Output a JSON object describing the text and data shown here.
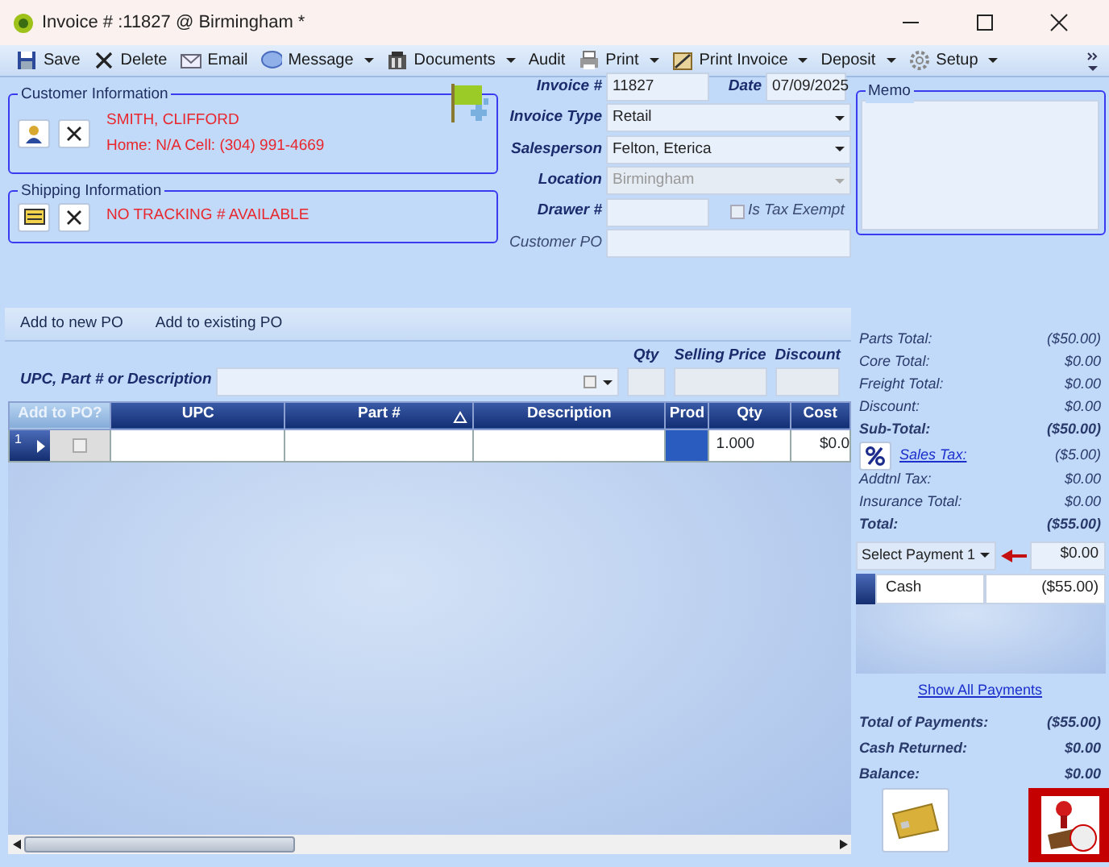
{
  "window": {
    "title": "Invoice # :11827 @ Birmingham *"
  },
  "toolbar": [
    {
      "label": "Save",
      "kind": "save",
      "dropdown": false
    },
    {
      "label": "Delete",
      "kind": "delete",
      "dropdown": false
    },
    {
      "label": "Email",
      "kind": "email",
      "dropdown": false
    },
    {
      "label": "Message",
      "kind": "message",
      "dropdown": true
    },
    {
      "label": "Documents",
      "kind": "documents",
      "dropdown": true
    },
    {
      "label": "Audit",
      "kind": "plain",
      "dropdown": false
    },
    {
      "label": "Print",
      "kind": "print",
      "dropdown": true
    },
    {
      "label": "Print Invoice",
      "kind": "printinvoice",
      "dropdown": true
    },
    {
      "label": "Deposit",
      "kind": "plain",
      "dropdown": true
    },
    {
      "label": "Setup",
      "kind": "setup",
      "dropdown": true
    }
  ],
  "customer": {
    "legend": "Customer Information",
    "name": "SMITH, CLIFFORD",
    "phone": "Home: N/A Cell: (304) 991-4669"
  },
  "shipping": {
    "legend": "Shipping Information",
    "tracking": "NO TRACKING # AVAILABLE"
  },
  "invoice": {
    "number": {
      "label": "Invoice #",
      "value": "11827"
    },
    "date": {
      "label": "Date",
      "value": "07/09/2025"
    },
    "type": {
      "label": "Invoice Type",
      "value": "Retail"
    },
    "salesperson": {
      "label": "Salesperson",
      "value": "Felton, Eterica"
    },
    "location": {
      "label": "Location",
      "value": "Birmingham",
      "disabled": true
    },
    "drawer": {
      "label": "Drawer #"
    },
    "tax_exempt": {
      "label": "Is Tax Exempt",
      "checked": false
    },
    "customer_po": {
      "label": "Customer PO"
    }
  },
  "po_tabs": [
    "Add to new PO",
    "Add to existing PO"
  ],
  "entry": {
    "label": "UPC, Part # or Description",
    "qty_label": "Qty",
    "price_label": "Selling Price",
    "discount_label": "Discount"
  },
  "grid": {
    "columns": [
      {
        "label": "Add to PO?",
        "sorted": false
      },
      {
        "label": "UPC",
        "sorted": false
      },
      {
        "label": "Part #",
        "sorted": true
      },
      {
        "label": "Description",
        "sorted": false
      },
      {
        "label": "Prod",
        "sorted": false
      },
      {
        "label": "Qty",
        "sorted": false
      },
      {
        "label": "Cost",
        "sorted": false
      }
    ],
    "rows": [
      {
        "row_no": "1",
        "add_to_po": false,
        "qty": "1.000",
        "cost": "$0.0"
      }
    ]
  },
  "memo": {
    "legend": "Memo"
  },
  "totals": [
    {
      "label": "Parts Total:",
      "value": "($50.00)",
      "kind": "normal"
    },
    {
      "label": "Core Total:",
      "value": "$0.00",
      "kind": "normal"
    },
    {
      "label": "Freight Total:",
      "value": "$0.00",
      "kind": "normal"
    },
    {
      "label": "Discount:",
      "value": "$0.00",
      "kind": "normal"
    },
    {
      "label": "Sub-Total:",
      "value": "($50.00)",
      "kind": "bold"
    },
    {
      "label": "Sales Tax:",
      "value": "($5.00)",
      "kind": "link"
    },
    {
      "label": "Addtnl Tax:",
      "value": "$0.00",
      "kind": "normal"
    },
    {
      "label": "Insurance Total:",
      "value": "$0.00",
      "kind": "normal"
    },
    {
      "label": "Total:",
      "value": "($55.00)",
      "kind": "bold"
    }
  ],
  "payment": {
    "select_label": "Select Payment 1",
    "amount": "$0.00",
    "rows": [
      {
        "method": "Cash",
        "amount": "($55.00)"
      }
    ],
    "show_all": "Show All Payments"
  },
  "summary": [
    {
      "label": "Total of Payments:",
      "value": "($55.00)"
    },
    {
      "label": "Cash Returned:",
      "value": "$0.00"
    },
    {
      "label": "Balance:",
      "value": "$0.00"
    }
  ]
}
